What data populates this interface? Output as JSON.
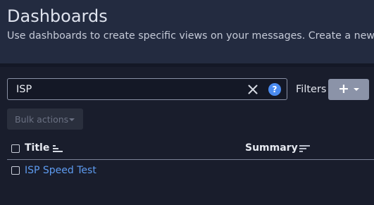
{
  "header": {
    "title": "Dashboards",
    "subtitle": "Use dashboards to create specific views on your messages. Create a new dashboard"
  },
  "search": {
    "value": "ISP",
    "clear_icon": "close-icon",
    "help_icon": "question-circle-icon",
    "help_glyph": "?"
  },
  "filters": {
    "label": "Filters",
    "add_glyph": "+",
    "add_icon": "plus-icon"
  },
  "bulk_actions": {
    "label": "Bulk actions"
  },
  "table": {
    "columns": [
      {
        "label": "Title",
        "sort_icon": "sort-ascending-icon"
      },
      {
        "label": "Summary",
        "sort_icon": "sort-icon"
      }
    ],
    "rows": [
      {
        "title": "ISP Speed Test",
        "summary": ""
      }
    ]
  },
  "colors": {
    "background": "#191d2c",
    "header": "#232b40",
    "link": "#5e9bf0",
    "help_accent": "#4a8bf0",
    "add_button": "#8b93a8"
  }
}
